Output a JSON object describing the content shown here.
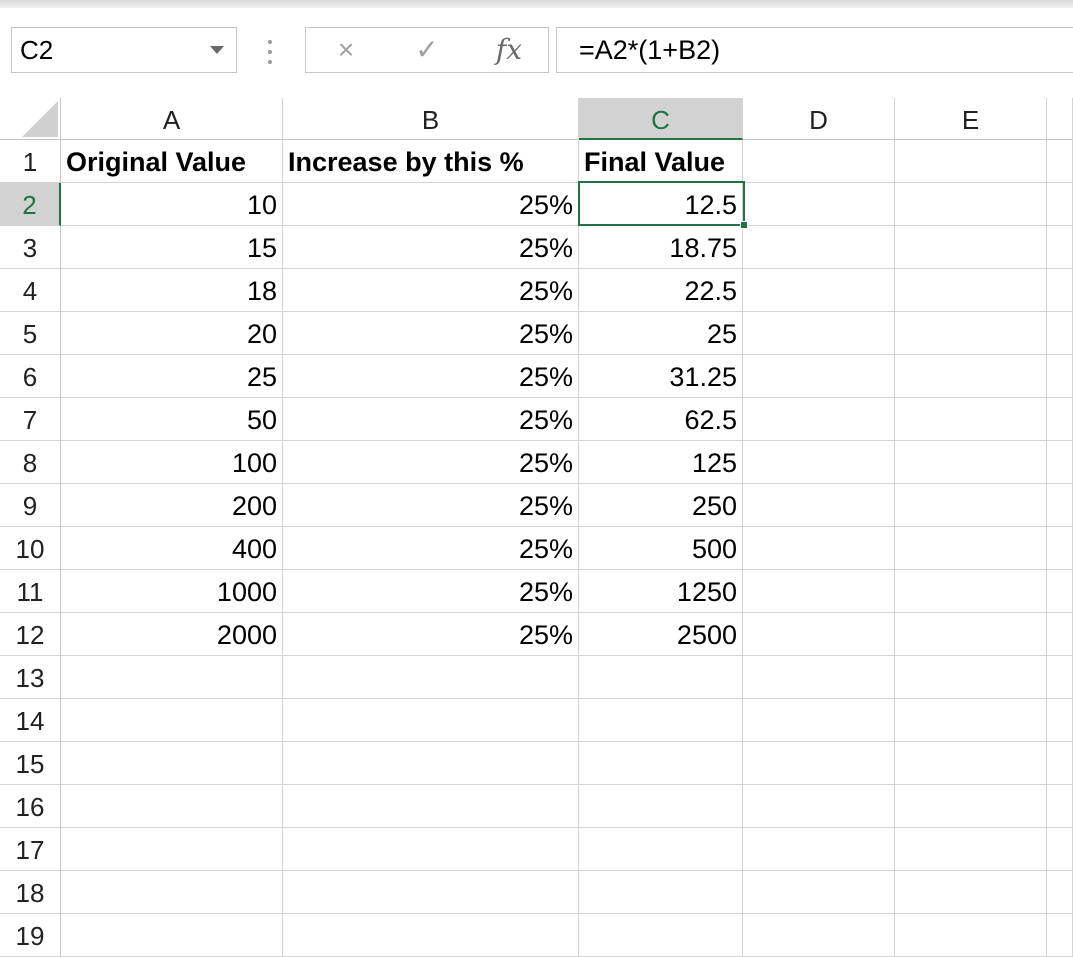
{
  "name_box": {
    "value": "C2"
  },
  "formula_bar": {
    "cancel_icon": "×",
    "enter_icon": "✓",
    "fx_label": "fx",
    "formula": "=A2*(1+B2)"
  },
  "columns": [
    "A",
    "B",
    "C",
    "D",
    "E"
  ],
  "selected_column": "C",
  "selected_row": "2",
  "row_numbers": [
    "1",
    "2",
    "3",
    "4",
    "5",
    "6",
    "7",
    "8",
    "9",
    "10",
    "11",
    "12",
    "13",
    "14",
    "15",
    "16",
    "17",
    "18",
    "19"
  ],
  "headers": {
    "a": "Original Value",
    "b": "Increase by this %",
    "c": "Final Value"
  },
  "rows": [
    {
      "a": "10",
      "b": "25%",
      "c": "12.5"
    },
    {
      "a": "15",
      "b": "25%",
      "c": "18.75"
    },
    {
      "a": "18",
      "b": "25%",
      "c": "22.5"
    },
    {
      "a": "20",
      "b": "25%",
      "c": "25"
    },
    {
      "a": "25",
      "b": "25%",
      "c": "31.25"
    },
    {
      "a": "50",
      "b": "25%",
      "c": "62.5"
    },
    {
      "a": "100",
      "b": "25%",
      "c": "125"
    },
    {
      "a": "200",
      "b": "25%",
      "c": "250"
    },
    {
      "a": "400",
      "b": "25%",
      "c": "500"
    },
    {
      "a": "1000",
      "b": "25%",
      "c": "1250"
    },
    {
      "a": "2000",
      "b": "25%",
      "c": "2500"
    }
  ],
  "colors": {
    "accent": "#217346",
    "header_selected_bg": "#d2d2d2",
    "gridline": "#d4d4d4"
  }
}
